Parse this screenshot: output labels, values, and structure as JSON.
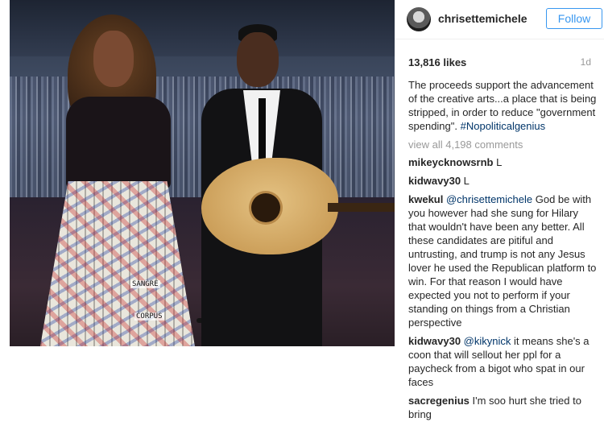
{
  "post": {
    "username": "chrisettemichele",
    "follow_label": "Follow",
    "likes": "13,816 likes",
    "age": "1d",
    "caption_text": "The proceeds support the advancement of the creative arts...a place that is being stripped, in order to reduce \"government spending\".",
    "caption_hashtag": "#Nopoliticalgenius",
    "view_all": "view all 4,198 comments"
  },
  "comments": [
    {
      "user": "mikeycknowsrnb",
      "text": "L"
    },
    {
      "user": "kidwavy30",
      "text": "L"
    },
    {
      "user": "kwekul",
      "mention": "@chrisettemichele",
      "text": "God be with you however had she sung for Hilary that wouldn't have been any better. All these candidates are pitiful and untrusting, and trump is not any Jesus lover he used the Republican platform to win. For that reason I would have expected you not to perform if your standing on things from a Christian perspective"
    },
    {
      "user": "kidwavy30",
      "mention": "@kikynick",
      "text": "it means she's a coon that will sellout her ppl for a paycheck from a bigot who spat in our faces"
    },
    {
      "user": "sacregenius",
      "text": "I'm soo hurt she tried to bring"
    }
  ],
  "photo": {
    "skirt_text_1": "SANGRE",
    "skirt_text_2": "CORPUS"
  }
}
